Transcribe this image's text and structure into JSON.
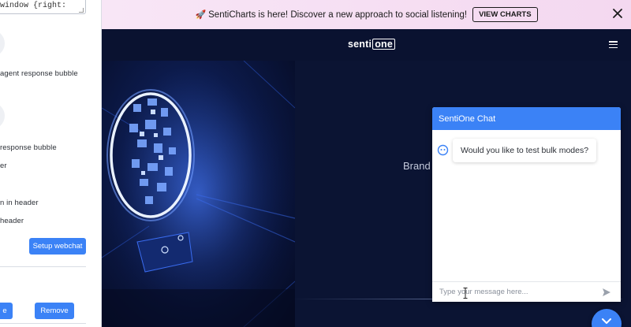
{
  "left_panel": {
    "code_snippet": "window {right:",
    "labels": {
      "agent_bubble": "agent response bubble",
      "response_bubble": "response bubble",
      "header_option": "er",
      "icon_in_header": "n in header",
      "in_header": " header"
    },
    "setup_button": "Setup webchat",
    "partial_button": "e",
    "remove_button": "Remove"
  },
  "announcement": {
    "text": "SentiCharts is here! Discover a new approach to social listening!",
    "rocket_icon": "rocket-icon",
    "cta_label": "VIEW CHARTS",
    "close_icon": "close-icon"
  },
  "site_header": {
    "logo_senti": "senti",
    "logo_one": "one",
    "menu_icon": "hamburger-menu-icon"
  },
  "hero": {
    "title_partial": "Brand"
  },
  "chat": {
    "title": "SentiOne Chat",
    "bot_icon": "bot-avatar-icon",
    "messages": [
      {
        "from": "bot",
        "text": "Would you like to test bulk modes?"
      }
    ],
    "input_placeholder": "Type your message here...",
    "send_icon": "send-icon"
  },
  "launcher_icon": "chevron-down-icon",
  "colors": {
    "primary": "#3b82f6",
    "page_bg": "#0a1230",
    "announcement_bg": "#f6dff3"
  }
}
